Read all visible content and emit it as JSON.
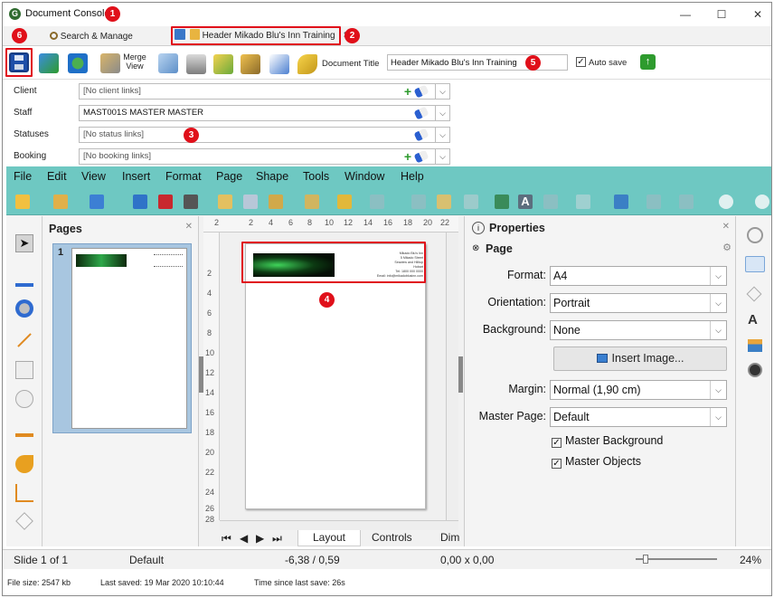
{
  "window": {
    "title": "Document Console",
    "minimize": "—",
    "maximize": "☐",
    "close": "✕"
  },
  "tabs": [
    {
      "label": "Search & Manage"
    },
    {
      "label": "Header Mikado Blu's Inn Training",
      "close": "✖"
    }
  ],
  "markers": [
    "1",
    "2",
    "3",
    "4",
    "5",
    "6"
  ],
  "toolbar": {
    "merge_view_label": "Merge View",
    "document_title_label": "Document Title",
    "document_title_value": "Header Mikado Blu's Inn Training",
    "auto_save_label": "Auto save",
    "auto_save_checked": true
  },
  "fields": [
    {
      "label": "Client",
      "value": "[No client links]",
      "has_add": true
    },
    {
      "label": "Staff",
      "value": "MAST001S MASTER MASTER",
      "has_add": false
    },
    {
      "label": "Statuses",
      "value": "[No status links]",
      "has_add": false
    },
    {
      "label": "Booking",
      "value": "[No booking links]",
      "has_add": true
    }
  ],
  "libreoffice": {
    "menu": [
      "File",
      "Edit",
      "View",
      "Insert",
      "Format",
      "Page",
      "Shape",
      "Tools",
      "Window",
      "Help"
    ],
    "pages_panel": {
      "title": "Pages",
      "page_number": "1"
    },
    "ruler_numbers": [
      "2",
      "2",
      "4",
      "6",
      "8",
      "10",
      "12",
      "14",
      "16",
      "18",
      "20",
      "22"
    ],
    "vruler_numbers": [
      "2",
      "4",
      "6",
      "8",
      "10",
      "12",
      "14",
      "16",
      "18",
      "20",
      "22",
      "24",
      "26",
      "28"
    ],
    "bottom_tabs": [
      "Layout",
      "Controls",
      "Dim"
    ],
    "properties": {
      "title": "Properties",
      "section": "Page",
      "format_label": "Format:",
      "format_value": "A4",
      "orientation_label": "Orientation:",
      "orientation_value": "Portrait",
      "background_label": "Background:",
      "background_value": "None",
      "insert_image": "Insert Image...",
      "margin_label": "Margin:",
      "margin_value": "Normal (1,90 cm)",
      "master_page_label": "Master Page:",
      "master_page_value": "Default",
      "master_background": "Master Background",
      "master_objects": "Master Objects"
    },
    "status": {
      "slide": "Slide 1 of 1",
      "layout": "Default",
      "position": "-6,38 / 0,59",
      "size": "0,00 x 0,00",
      "zoom": "24%"
    },
    "header_text_lines": [
      "Mikado Blu's Inn",
      "5 Mikado Street",
      "Seaview and Hilltop",
      "Hobart",
      "Tel: 1800 000 0000",
      "Email: info@mikadoblusinn.com"
    ]
  },
  "footer": {
    "file_size": "File size: 2547 kb",
    "last_saved": "Last saved: 19 Mar 2020 10:10:44",
    "time_since": "Time since last save: 26s"
  },
  "colors": {
    "accent_red": "#e0101a",
    "menubar_teal": "#6ec8c2"
  }
}
